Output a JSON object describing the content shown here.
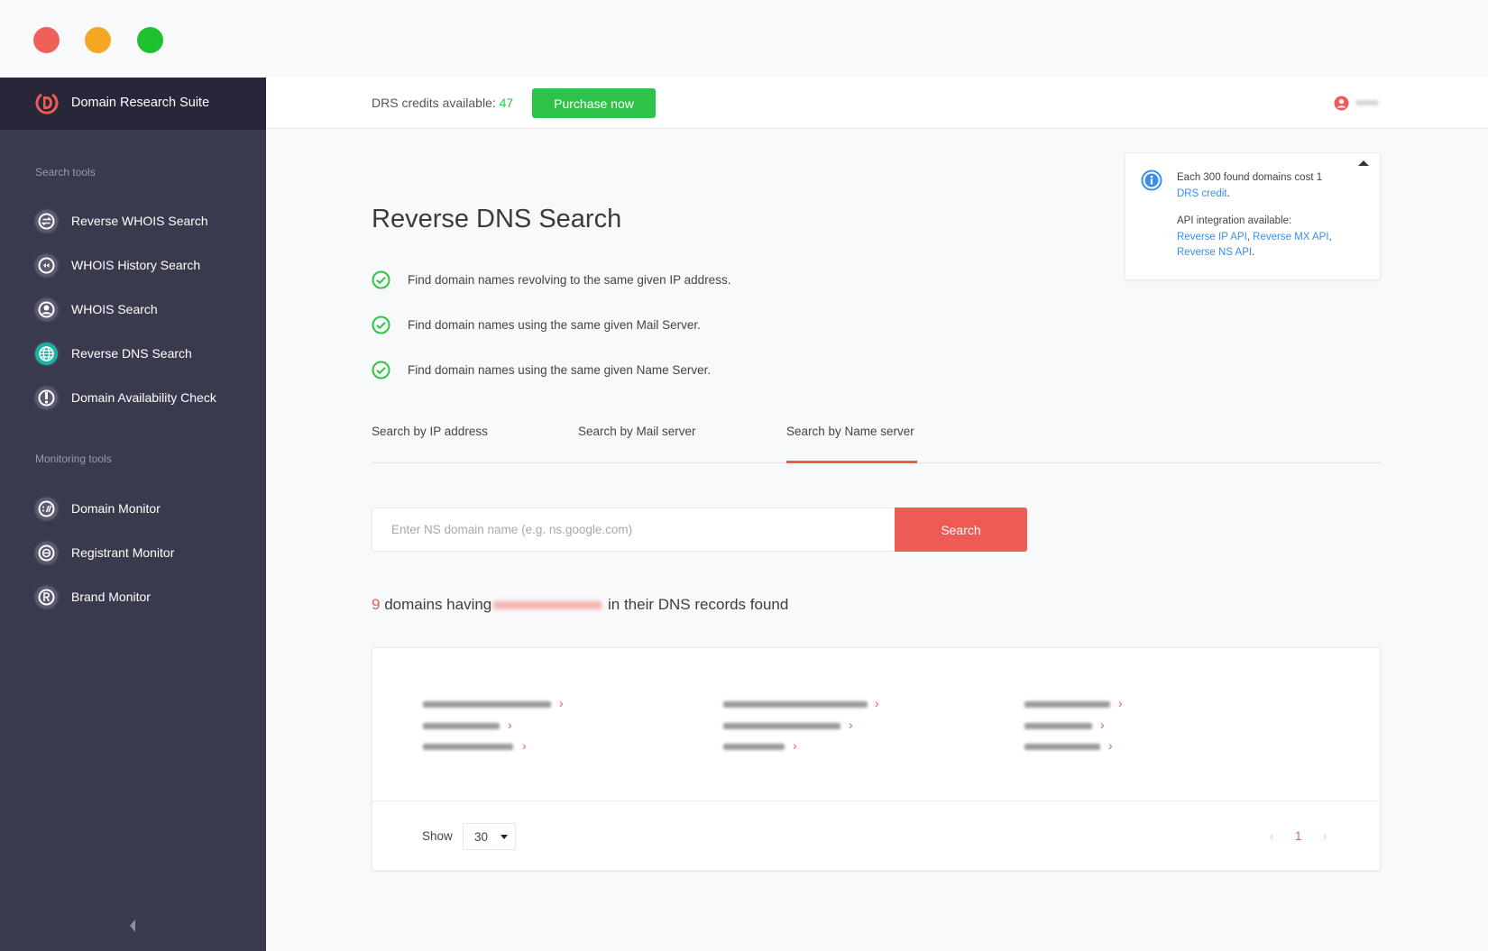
{
  "window": {
    "traffic_lights": [
      {
        "name": "close",
        "color": "#f0605a"
      },
      {
        "name": "minimize",
        "color": "#f5a623"
      },
      {
        "name": "maximize",
        "color": "#1fc12f"
      }
    ]
  },
  "sidebar": {
    "brand": "Domain Research Suite",
    "sections": [
      {
        "title": "Search tools",
        "items": [
          {
            "label": "Reverse WHOIS Search",
            "icon": "reverse-arrows-icon",
            "active": false
          },
          {
            "label": "WHOIS History Search",
            "icon": "rewind-icon",
            "active": false
          },
          {
            "label": "WHOIS Search",
            "icon": "user-circle-icon",
            "active": false
          },
          {
            "label": "Reverse DNS Search",
            "icon": "globe-icon",
            "active": true
          },
          {
            "label": "Domain Availability Check",
            "icon": "availability-icon",
            "active": false
          }
        ]
      },
      {
        "title": "Monitoring tools",
        "items": [
          {
            "label": "Domain Monitor",
            "icon": "domain-monitor-icon",
            "active": false
          },
          {
            "label": "Registrant Monitor",
            "icon": "registrant-icon",
            "active": false
          },
          {
            "label": "Brand Monitor",
            "icon": "registered-icon",
            "active": false
          }
        ]
      }
    ]
  },
  "header": {
    "credits_label": "DRS credits available: ",
    "credits_value": "47",
    "purchase_label": "Purchase now",
    "accent_green": "#2fc248"
  },
  "info_box": {
    "cost_text": "Each 300 found domains cost 1",
    "cost_link": "DRS credit",
    "api_text": "API integration available:",
    "api_links": [
      "Reverse IP API",
      "Reverse MX API",
      "Reverse NS API"
    ]
  },
  "main": {
    "title": "Reverse DNS Search",
    "features": [
      "Find domain names revolving to the same given IP address.",
      "Find domain names using the same given Mail Server.",
      "Find domain names using the same given Name Server."
    ],
    "tabs": [
      {
        "label": "Search by IP address",
        "active": false
      },
      {
        "label": "Search by Mail server",
        "active": false
      },
      {
        "label": "Search by Name server",
        "active": true
      }
    ],
    "search": {
      "value": "",
      "placeholder": "Enter NS domain name (e.g. ns.google.com)",
      "button_label": "Search"
    },
    "result": {
      "count": "9",
      "prefix": " domains having",
      "suffix": " in their DNS records found"
    },
    "results_card": {
      "domains_redacted_count": 9,
      "show_label": "Show",
      "page_size": "30",
      "current_page": "1",
      "prev_label": "‹",
      "next_label": "›"
    },
    "accent_red": "#ef5a55"
  }
}
